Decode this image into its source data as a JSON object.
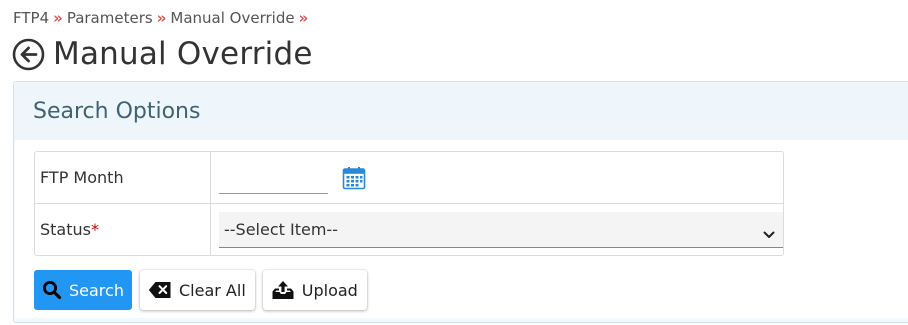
{
  "breadcrumb": {
    "items": [
      "FTP4",
      "Parameters",
      "Manual Override"
    ],
    "separator": "»"
  },
  "page": {
    "title": "Manual Override",
    "back_icon": "arrow-left-circle-icon"
  },
  "search_panel": {
    "title": "Search Options",
    "fields": {
      "ftp_month": {
        "label": "FTP Month",
        "value": "",
        "icon": "calendar-icon"
      },
      "status": {
        "label": "Status",
        "required_mark": "*",
        "selected": "--Select Item--",
        "icon": "chevron-down-icon"
      }
    },
    "buttons": {
      "search": {
        "label": "Search",
        "icon": "search-icon"
      },
      "clear_all": {
        "label": "Clear All",
        "icon": "backspace-icon"
      },
      "upload": {
        "label": "Upload",
        "icon": "upload-tray-icon"
      }
    }
  },
  "colors": {
    "primary": "#2196f3",
    "breadcrumb_separator": "#d9534f",
    "required": "#cc0000",
    "panel_title": "#3f6274"
  }
}
